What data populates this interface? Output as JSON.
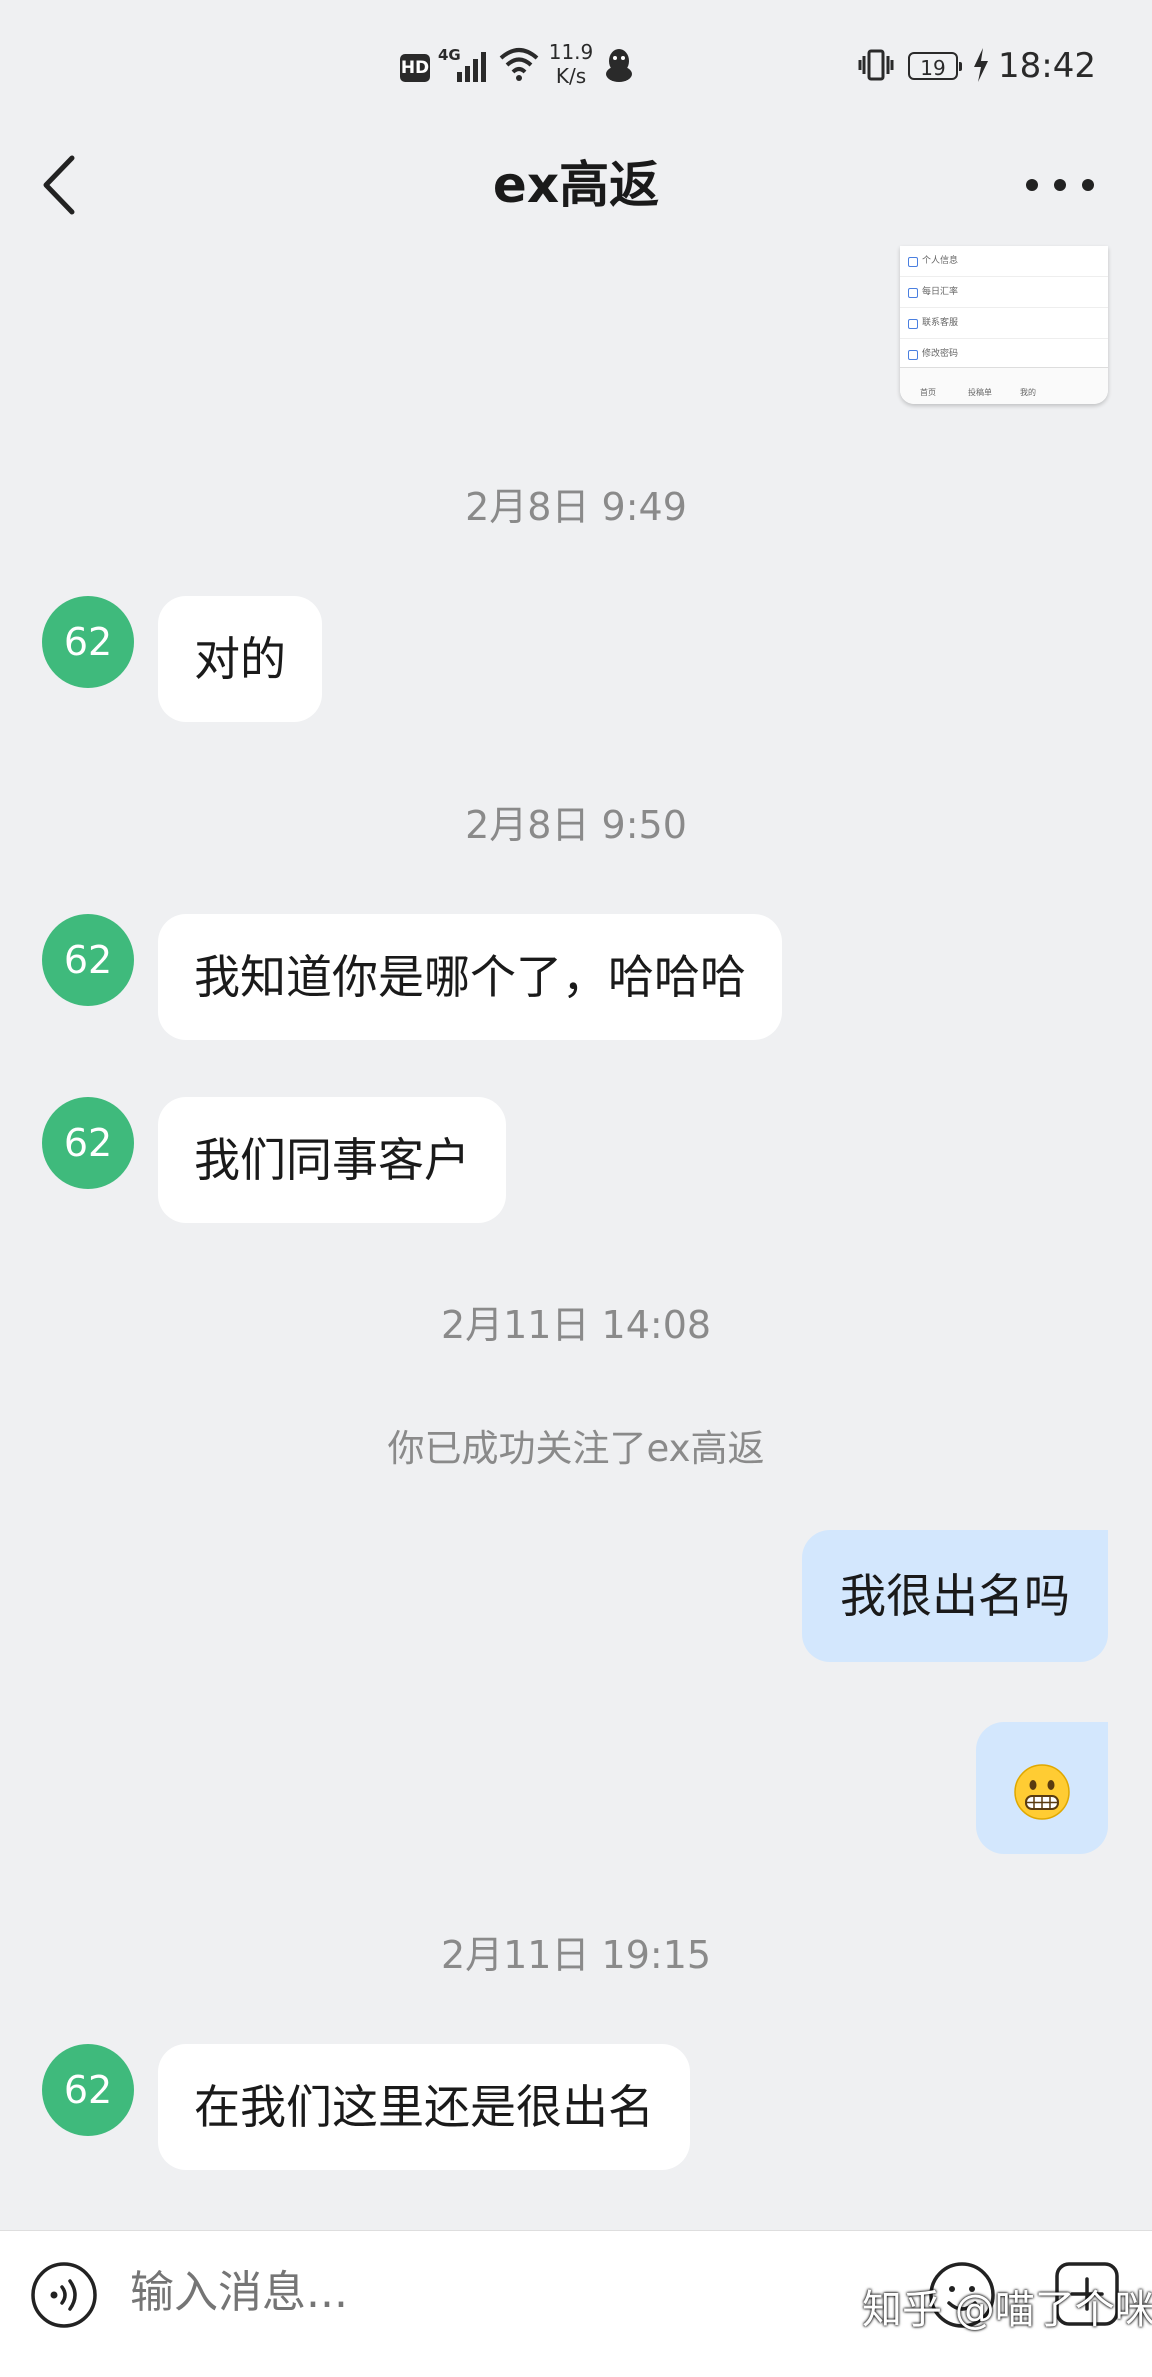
{
  "status_bar": {
    "hd": "HD",
    "network": "4G",
    "speed_value": "11.9",
    "speed_unit": "K/s",
    "battery": "19",
    "time": "18:42"
  },
  "header": {
    "title": "ex高返"
  },
  "preview": {
    "rows": [
      "个人信息",
      "每日汇率",
      "联系客服",
      "修改密码"
    ],
    "tabs": [
      "首页",
      "投稿单",
      "我的"
    ]
  },
  "messages": [
    {
      "type": "timestamp",
      "text": "2月8日 9:49"
    },
    {
      "type": "incoming",
      "avatar": "62",
      "text": "对的"
    },
    {
      "type": "timestamp",
      "text": "2月8日 9:50"
    },
    {
      "type": "incoming",
      "avatar": "62",
      "text": "我知道你是哪个了，哈哈哈"
    },
    {
      "type": "incoming",
      "avatar": "62",
      "text": "我们同事客户"
    },
    {
      "type": "timestamp",
      "text": "2月11日 14:08"
    },
    {
      "type": "system",
      "text": "你已成功关注了ex高返"
    },
    {
      "type": "outgoing",
      "text": "我很出名吗"
    },
    {
      "type": "outgoing",
      "emoji": "grimacing-face"
    },
    {
      "type": "timestamp",
      "text": "2月11日 19:15"
    },
    {
      "type": "incoming",
      "avatar": "62",
      "text": "在我们这里还是很出名"
    }
  ],
  "input": {
    "placeholder": "输入消息..."
  },
  "watermark": "知乎 @喵了个咪啊",
  "colors": {
    "background": "#eff0f2",
    "avatar": "#3fba7c",
    "outgoing_bubble": "#d3e7fd",
    "incoming_bubble": "#ffffff"
  }
}
